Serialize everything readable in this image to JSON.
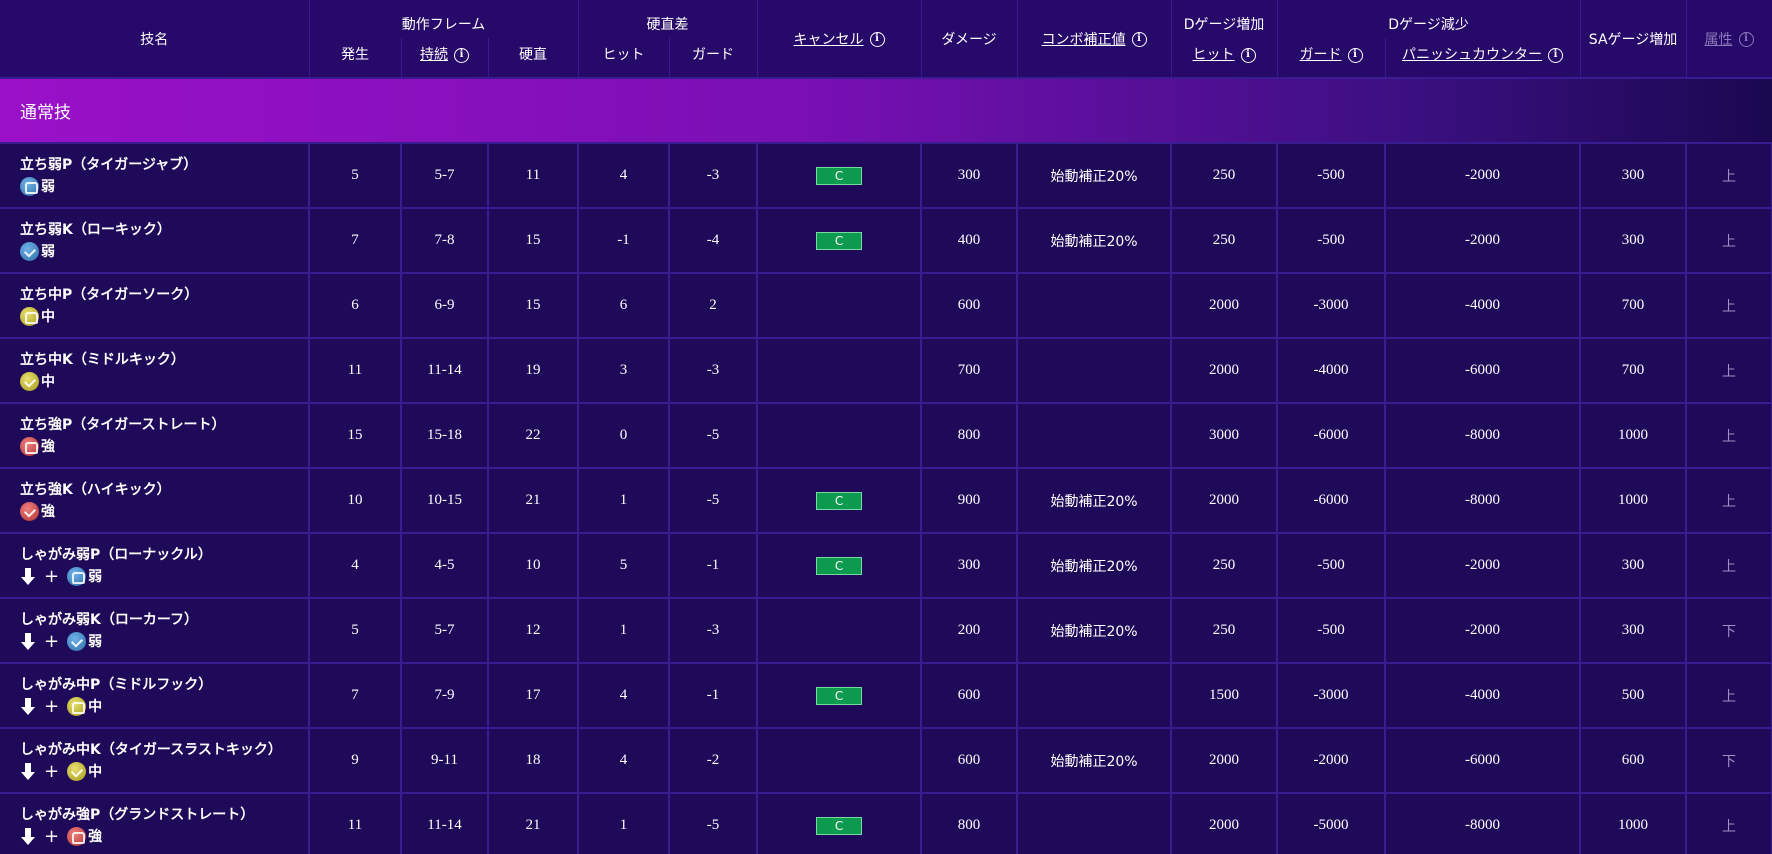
{
  "header": {
    "move_name": "技名",
    "frame_group": "動作フレーム",
    "startup": "発生",
    "active": "持続",
    "recovery": "硬直",
    "advantage_group": "硬直差",
    "on_hit": "ヒット",
    "on_block": "ガード",
    "cancel": "キャンセル",
    "damage": "ダメージ",
    "combo_scaling": "コンボ補正値",
    "drive_gain_group": "Dゲージ増加",
    "drive_gain_hit": "ヒット",
    "drive_reduce_group": "Dゲージ減少",
    "drive_reduce_block": "ガード",
    "drive_reduce_punish": "パニッシュカウンター",
    "sa_gain": "SAゲージ増加",
    "attribute": "属性",
    "info_glyph": "i"
  },
  "section": {
    "title": "通常技"
  },
  "input_glyphs": {
    "plus": "+"
  },
  "icons": {
    "info": "info-circle-icon",
    "down": "down-arrow-icon",
    "light_punch": "light-punch-icon",
    "light_kick": "light-kick-icon",
    "medium_punch": "medium-punch-icon",
    "medium_kick": "medium-kick-icon",
    "heavy_punch": "heavy-punch-icon",
    "heavy_kick": "heavy-kick-icon"
  },
  "colors": {
    "background": "#1a0850",
    "header_bg": "#27096a",
    "section_accent": "#9a10c8",
    "cancel_badge": "#0c9a4e"
  },
  "rows": [
    {
      "name": "立ち弱P（タイガージャブ）",
      "down": false,
      "btn": "p-light",
      "strength": "弱",
      "startup": "5",
      "active": "5-7",
      "recovery": "11",
      "hit": "4",
      "block": "-3",
      "cancel": "C",
      "damage": "300",
      "combo": "始動補正20%",
      "dg_hit": "250",
      "dr_block": "-500",
      "dr_punish": "-2000",
      "sa": "300",
      "attr": "上"
    },
    {
      "name": "立ち弱K（ローキック）",
      "down": false,
      "btn": "k-light",
      "strength": "弱",
      "startup": "7",
      "active": "7-8",
      "recovery": "15",
      "hit": "-1",
      "block": "-4",
      "cancel": "C",
      "damage": "400",
      "combo": "始動補正20%",
      "dg_hit": "250",
      "dr_block": "-500",
      "dr_punish": "-2000",
      "sa": "300",
      "attr": "上"
    },
    {
      "name": "立ち中P（タイガーソーク）",
      "down": false,
      "btn": "p-med",
      "strength": "中",
      "startup": "6",
      "active": "6-9",
      "recovery": "15",
      "hit": "6",
      "block": "2",
      "cancel": "",
      "damage": "600",
      "combo": "",
      "dg_hit": "2000",
      "dr_block": "-3000",
      "dr_punish": "-4000",
      "sa": "700",
      "attr": "上"
    },
    {
      "name": "立ち中K（ミドルキック）",
      "down": false,
      "btn": "k-med",
      "strength": "中",
      "startup": "11",
      "active": "11-14",
      "recovery": "19",
      "hit": "3",
      "block": "-3",
      "cancel": "",
      "damage": "700",
      "combo": "",
      "dg_hit": "2000",
      "dr_block": "-4000",
      "dr_punish": "-6000",
      "sa": "700",
      "attr": "上"
    },
    {
      "name": "立ち強P（タイガーストレート）",
      "down": false,
      "btn": "p-heavy",
      "strength": "強",
      "startup": "15",
      "active": "15-18",
      "recovery": "22",
      "hit": "0",
      "block": "-5",
      "cancel": "",
      "damage": "800",
      "combo": "",
      "dg_hit": "3000",
      "dr_block": "-6000",
      "dr_punish": "-8000",
      "sa": "1000",
      "attr": "上"
    },
    {
      "name": "立ち強K（ハイキック）",
      "down": false,
      "btn": "k-heavy",
      "strength": "強",
      "startup": "10",
      "active": "10-15",
      "recovery": "21",
      "hit": "1",
      "block": "-5",
      "cancel": "C",
      "damage": "900",
      "combo": "始動補正20%",
      "dg_hit": "2000",
      "dr_block": "-6000",
      "dr_punish": "-8000",
      "sa": "1000",
      "attr": "上"
    },
    {
      "name": "しゃがみ弱P（ローナックル）",
      "down": true,
      "btn": "p-light",
      "strength": "弱",
      "startup": "4",
      "active": "4-5",
      "recovery": "10",
      "hit": "5",
      "block": "-1",
      "cancel": "C",
      "damage": "300",
      "combo": "始動補正20%",
      "dg_hit": "250",
      "dr_block": "-500",
      "dr_punish": "-2000",
      "sa": "300",
      "attr": "上"
    },
    {
      "name": "しゃがみ弱K（ローカーフ）",
      "down": true,
      "btn": "k-light",
      "strength": "弱",
      "startup": "5",
      "active": "5-7",
      "recovery": "12",
      "hit": "1",
      "block": "-3",
      "cancel": "",
      "damage": "200",
      "combo": "始動補正20%",
      "dg_hit": "250",
      "dr_block": "-500",
      "dr_punish": "-2000",
      "sa": "300",
      "attr": "下"
    },
    {
      "name": "しゃがみ中P（ミドルフック）",
      "down": true,
      "btn": "p-med",
      "strength": "中",
      "startup": "7",
      "active": "7-9",
      "recovery": "17",
      "hit": "4",
      "block": "-1",
      "cancel": "C",
      "damage": "600",
      "combo": "",
      "dg_hit": "1500",
      "dr_block": "-3000",
      "dr_punish": "-4000",
      "sa": "500",
      "attr": "上"
    },
    {
      "name": "しゃがみ中K（タイガースラストキック）",
      "down": true,
      "btn": "k-med",
      "strength": "中",
      "startup": "9",
      "active": "9-11",
      "recovery": "18",
      "hit": "4",
      "block": "-2",
      "cancel": "",
      "damage": "600",
      "combo": "始動補正20%",
      "dg_hit": "2000",
      "dr_block": "-2000",
      "dr_punish": "-6000",
      "sa": "600",
      "attr": "下"
    },
    {
      "name": "しゃがみ強P（グランドストレート）",
      "down": true,
      "btn": "p-heavy",
      "strength": "強",
      "startup": "11",
      "active": "11-14",
      "recovery": "21",
      "hit": "1",
      "block": "-5",
      "cancel": "C",
      "damage": "800",
      "combo": "",
      "dg_hit": "2000",
      "dr_block": "-5000",
      "dr_punish": "-8000",
      "sa": "1000",
      "attr": "上"
    }
  ]
}
